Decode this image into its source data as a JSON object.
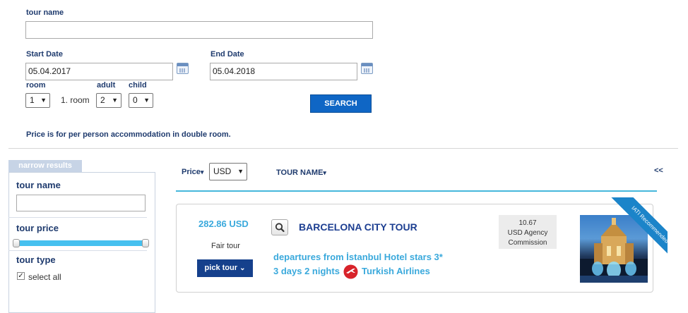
{
  "search_form": {
    "tour_name_label": "tour name",
    "tour_name_value": "",
    "start_date_label": "Start Date",
    "start_date_value": "05.04.2017",
    "end_date_label": "End Date",
    "end_date_value": "05.04.2018",
    "room_label": "room",
    "room_value": "1",
    "room_index_text": "1. room",
    "adult_label": "adult",
    "adult_value": "2",
    "child_label": "child",
    "child_value": "0",
    "search_button": "SEARCH",
    "price_note": "Price is for per person accommodation in double room."
  },
  "sidebar": {
    "header": "narrow results",
    "tour_name_label": "tour name",
    "tour_name_value": "",
    "tour_price_label": "tour price",
    "price_range_fraction": [
      0.0,
      1.0
    ],
    "tour_type_label": "tour type",
    "select_all_label": "select all",
    "select_all_checked": true
  },
  "sort_bar": {
    "price_label": "Price",
    "currency_value": "USD",
    "tour_name_sort_label": "TOUR NAME",
    "collapse_link": "<<"
  },
  "results": [
    {
      "price": "282.86 USD",
      "price_type": "Fair tour",
      "pick_button": "pick tour",
      "title": "BARCELONA CITY TOUR",
      "details_line1": "departures from İstanbul Hotel stars 3*",
      "details_line2_prefix": "3 days 2 nights",
      "airline": "Turkish Airlines",
      "commission_value": "10.67",
      "commission_line2": "USD Agency",
      "commission_line3": "Commission",
      "ribbon_text": "IATI Recommended"
    }
  ],
  "colors": {
    "primary_blue": "#0f66c5",
    "dark_navy": "#15408c",
    "label_navy": "#1f3b6e",
    "accent_cyan": "#46b8dc",
    "price_cyan": "#3aa9dc",
    "airline_red": "#d8232a"
  }
}
